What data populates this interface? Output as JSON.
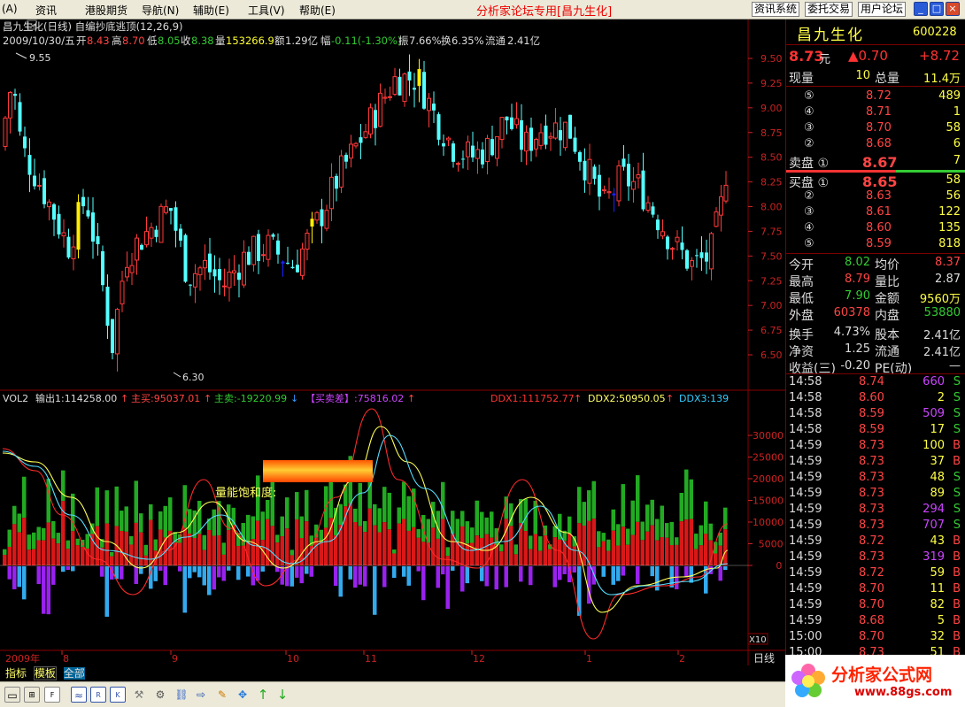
{
  "menu": {
    "items": [
      "(A)",
      "资讯",
      "港股期货",
      "导航(N)",
      "辅助(E)",
      "工具(V)",
      "帮助(E)"
    ],
    "title": "分析家论坛专用[昌九生化]",
    "buttons": [
      "资讯系统",
      "委托交易",
      "用户论坛"
    ]
  },
  "chart": {
    "header1": "昌九生化(日线) 自编抄底逃顶(12,26,9)",
    "date": "2009/10/30/五",
    "open_label": "开",
    "open": "8.43",
    "high_label": "高",
    "high": "8.70",
    "low_label": "低",
    "low": "8.05",
    "close_label": "收",
    "close": "8.38",
    "vol_label": "量",
    "vol": "153266.9",
    "amt_label": "额",
    "amt": "1.29亿",
    "chg_label": "幅",
    "chg": "-0.11(-1.30%)",
    "amp_label": "振",
    "amp": "7.66%",
    "turn_label": "换",
    "turn": "6.35%",
    "float_label": "流通",
    "float": "2.41亿",
    "max_mark": "9.55",
    "min_mark": "6.30",
    "price_ticks": [
      "9.50",
      "9.25",
      "9.00",
      "8.75",
      "8.50",
      "8.25",
      "8.00",
      "7.75",
      "7.50",
      "7.25",
      "7.00",
      "6.75",
      "6.50"
    ],
    "ind_name": "VOL2",
    "ind_out": "输出1:114258.00",
    "ind_buy": "主买:95037.01",
    "ind_sell": "主卖:-19220.99",
    "ind_diff": "【买卖差】:75816.02",
    "ddx1": "DDX1:111752.77",
    "ddx2": "DDX2:50950.05",
    "ddx3": "DDX3:139",
    "vol_ticks": [
      "30000",
      "25000",
      "20000",
      "15000",
      "10000",
      "5000",
      "0"
    ],
    "energy_label": "量能饱和度:",
    "x10": "X10",
    "months": [
      "2009年",
      "8",
      "9",
      "10",
      "11",
      "12",
      "1",
      "2"
    ],
    "period": "日线"
  },
  "quote": {
    "name": "昌九生化",
    "code": "600228",
    "price": "8.73",
    "price_unit": "元",
    "change": "▲0.70",
    "change2": "+8.72",
    "cur_vol_label": "现量",
    "cur_vol": "10",
    "tot_vol_label": "总量",
    "tot_vol": "11.4万",
    "sell": [
      [
        "⑤",
        "8.72",
        "489"
      ],
      [
        "④",
        "8.71",
        "1"
      ],
      [
        "③",
        "8.70",
        "58"
      ],
      [
        "②",
        "8.68",
        "6"
      ],
      [
        "卖盘 ①",
        "8.67",
        "7"
      ]
    ],
    "buy": [
      [
        "买盘 ①",
        "8.65",
        "58"
      ],
      [
        "②",
        "8.63",
        "56"
      ],
      [
        "③",
        "8.61",
        "122"
      ],
      [
        "④",
        "8.60",
        "135"
      ],
      [
        "⑤",
        "8.59",
        "818"
      ]
    ],
    "stats": [
      [
        "今开",
        "8.02",
        "均价",
        "8.37"
      ],
      [
        "最高",
        "8.79",
        "量比",
        "2.87"
      ],
      [
        "最低",
        "7.90",
        "金额",
        "9560万"
      ],
      [
        "外盘",
        "60378",
        "内盘",
        "53880"
      ],
      [
        "换手",
        "4.73%",
        "股本",
        "2.41亿"
      ],
      [
        "净资",
        "1.25",
        "流通",
        "2.41亿"
      ],
      [
        "收益(三)",
        "-0.20",
        "PE(动)",
        "—"
      ]
    ],
    "ticks": [
      [
        "14:58",
        "8.74",
        "660",
        "S"
      ],
      [
        "14:58",
        "8.60",
        "2",
        "S"
      ],
      [
        "14:58",
        "8.59",
        "509",
        "S"
      ],
      [
        "14:58",
        "8.59",
        "17",
        "S"
      ],
      [
        "14:59",
        "8.73",
        "100",
        "B"
      ],
      [
        "14:59",
        "8.73",
        "37",
        "B"
      ],
      [
        "14:59",
        "8.73",
        "48",
        "S"
      ],
      [
        "14:59",
        "8.73",
        "89",
        "S"
      ],
      [
        "14:59",
        "8.73",
        "294",
        "S"
      ],
      [
        "14:59",
        "8.73",
        "707",
        "S"
      ],
      [
        "14:59",
        "8.72",
        "43",
        "B"
      ],
      [
        "14:59",
        "8.73",
        "319",
        "B"
      ],
      [
        "14:59",
        "8.72",
        "59",
        "B"
      ],
      [
        "14:59",
        "8.70",
        "11",
        "B"
      ],
      [
        "14:59",
        "8.70",
        "82",
        "B"
      ],
      [
        "14:59",
        "8.68",
        "5",
        "B"
      ],
      [
        "15:00",
        "8.70",
        "32",
        "B"
      ],
      [
        "15:00",
        "8.73",
        "51",
        "B"
      ]
    ]
  },
  "bottom": {
    "tabs": [
      "指标",
      "模板",
      "全部"
    ]
  },
  "logo": {
    "text": "分析家公式网",
    "url": "www.88gs.com"
  }
}
